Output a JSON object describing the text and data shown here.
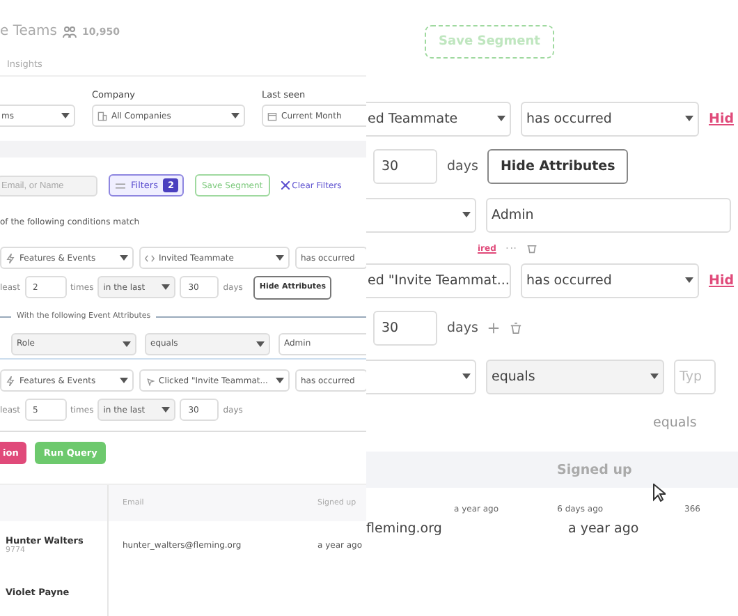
{
  "left_view": {
    "header": {
      "title": "e Teams",
      "count": "10,950"
    },
    "tabs": [
      {
        "label": "Insights",
        "selected": false
      }
    ],
    "filters": [
      {
        "value": "ms",
        "kind": "plain"
      },
      {
        "label": "Company",
        "value": "All Companies",
        "kind": "company"
      },
      {
        "label": "Last seen",
        "value": "Current Month",
        "kind": "date"
      }
    ],
    "toolbar": {
      "search_placeholder": "Email, or Name",
      "filters_label": "Filters",
      "filter_count": "2",
      "save_label": "Save Segment",
      "clear_label": "Clear Filters"
    },
    "match_text": "of the following conditions match",
    "conditions": [
      {
        "kind": "code",
        "source": "Features & Events",
        "event": "Invited Teammate",
        "operator": "has occurred",
        "prefix": "least",
        "times_value": "2",
        "times_label": "times",
        "window": "in the last",
        "days_value": "30",
        "days_label": "days",
        "toggle": "Hide Attributes",
        "attributes": {
          "legend": "With the following Event Attributes",
          "rows": [
            {
              "field": "Role",
              "operator": "equals",
              "value": "Admin"
            }
          ]
        }
      },
      {
        "kind": "click",
        "source": "Features & Events",
        "event": "Clicked \"Invite Teammat...",
        "operator": "has occurred",
        "prefix": "least",
        "times_value": "5",
        "times_label": "times",
        "window": "in the last",
        "days_value": "30",
        "days_label": "days"
      }
    ],
    "actions": [
      {
        "label": "ion",
        "kind": "danger"
      },
      {
        "label": "Run Query",
        "kind": "primary"
      }
    ],
    "table": {
      "columns": [
        "Email",
        "Signed up"
      ],
      "rows": [
        {
          "name": "Hunter Walters",
          "id": "9774",
          "email": "hunter_walters@fleming.org",
          "signed_up": "a year ago"
        },
        {
          "name": "Violet Payne"
        }
      ]
    }
  },
  "right_view": {
    "save_label": "Save Segment",
    "rows": [
      {
        "kind": "selects",
        "items": [
          "ed Teammate",
          "has occurred"
        ],
        "link": "Hid"
      },
      {
        "kind": "frequency",
        "value": "30",
        "unit": "days",
        "button": "Hide Attributes"
      },
      {
        "kind": "attribute",
        "value": "Admin"
      },
      {
        "kind": "actions",
        "link": "ired"
      },
      {
        "kind": "selects",
        "items": [
          "ed \"Invite Teammat...",
          "has occurred"
        ],
        "link": "Hid"
      },
      {
        "kind": "frequency",
        "value": "30",
        "unit": "days",
        "icons": true
      },
      {
        "kind": "attribute",
        "operator": "equals",
        "placeholder": "Typ"
      },
      {
        "kind": "ghost",
        "text": "equals"
      }
    ],
    "table": {
      "column": "Signed up",
      "small_cells": [
        "a year ago",
        "6 days ago",
        "366"
      ],
      "cells": [
        "fleming.org",
        "a year ago"
      ]
    }
  }
}
